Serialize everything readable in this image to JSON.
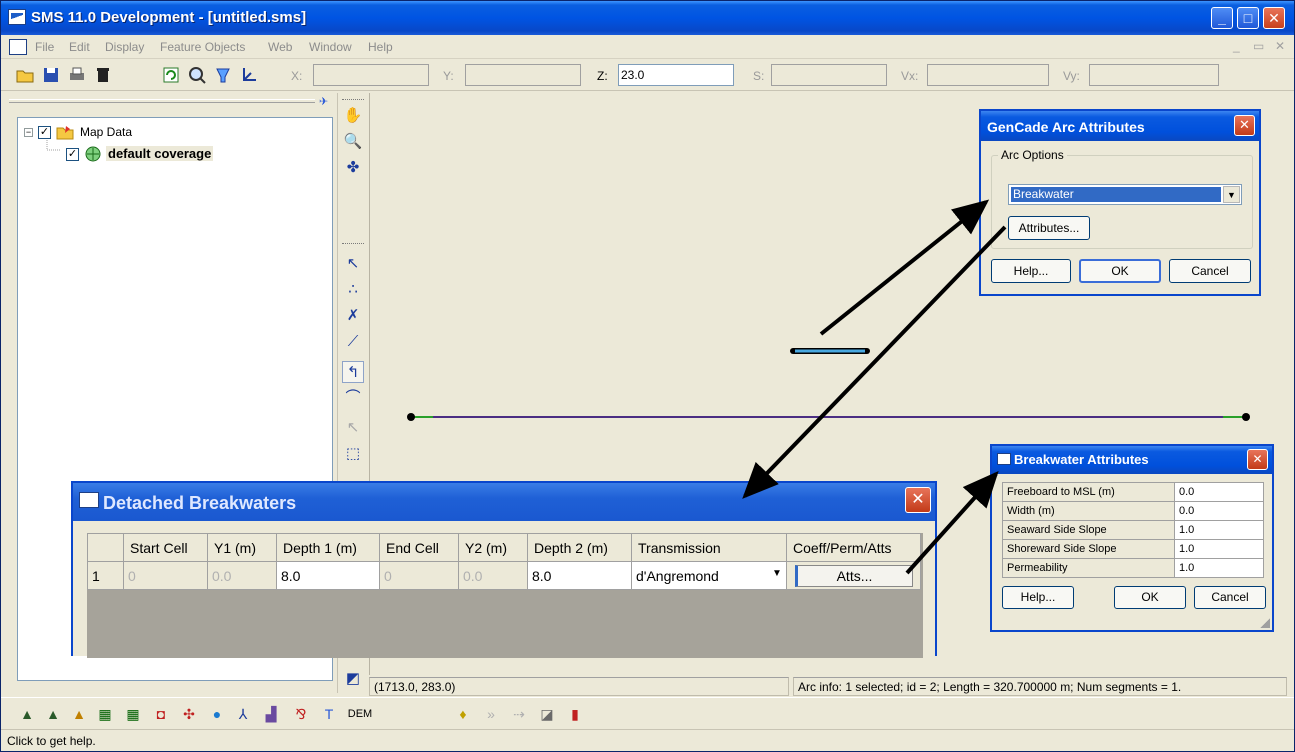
{
  "window": {
    "title": "SMS 11.0 Development - [untitled.sms]"
  },
  "menu": [
    "File",
    "Edit",
    "Display",
    "Feature Objects",
    "Web",
    "Window",
    "Help"
  ],
  "coords": {
    "x_label": "X:",
    "y_label": "Y:",
    "z_label": "Z:",
    "z_value": "23.0",
    "s_label": "S:",
    "vx_label": "Vx:",
    "vy_label": "Vy:"
  },
  "tree": {
    "root": "Map Data",
    "child": "default coverage"
  },
  "status": {
    "cursor": "(1713.0, 283.0)",
    "arc_info": "Arc info: 1 selected; id = 2; Length = 320.700000 m; Num segments = 1."
  },
  "help_text": "Click to get help.",
  "bottom_toolbar": {
    "dem_label": "DEM"
  },
  "gencade": {
    "title": "GenCade Arc Attributes",
    "group": "Arc Options",
    "selected": "Breakwater",
    "attributes_btn": "Attributes...",
    "help_btn": "Help...",
    "ok_btn": "OK",
    "cancel_btn": "Cancel"
  },
  "breakwater_attributes": {
    "title": "Breakwater Attributes",
    "rows": [
      {
        "name": "Freeboard to MSL (m)",
        "value": "0.0"
      },
      {
        "name": "Width (m)",
        "value": "0.0"
      },
      {
        "name": "Seaward Side Slope",
        "value": "1.0"
      },
      {
        "name": "Shoreward Side Slope",
        "value": "1.0"
      },
      {
        "name": "Permeability",
        "value": "1.0"
      }
    ],
    "help_btn": "Help...",
    "ok_btn": "OK",
    "cancel_btn": "Cancel"
  },
  "detached": {
    "title": "Detached Breakwaters",
    "columns": [
      "",
      "Start Cell",
      "Y1 (m)",
      "Depth 1 (m)",
      "End Cell",
      "Y2 (m)",
      "Depth 2 (m)",
      "Transmission",
      "Coeff/Perm/Atts"
    ],
    "row": {
      "index": "1",
      "start_cell": "0",
      "y1": "0.0",
      "depth1": "8.0",
      "end_cell": "0",
      "y2": "0.0",
      "depth2": "8.0",
      "transmission": "d'Angremond",
      "atts_btn": "Atts..."
    }
  },
  "colors": {
    "accent": "#0054e3",
    "selection": "#316ac5",
    "arc_line": "#4b2e83",
    "node": "#000000"
  }
}
